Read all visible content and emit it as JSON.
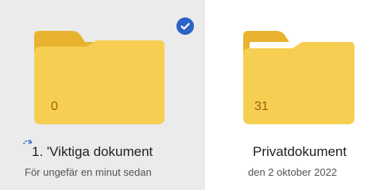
{
  "colors": {
    "accent": "#2c62c8",
    "folder_front": "#f6cf52",
    "folder_back": "#e9b330",
    "count_text": "#a05f0a",
    "selected_bg": "#ebebeb"
  },
  "folders": [
    {
      "name": "1. 'Viktiga dokument",
      "count": "0",
      "modified": "För ungefär en minut sedan",
      "selected": true,
      "icon": "folder-icon",
      "status_icon": "sync-icon"
    },
    {
      "name": "Privatdokument",
      "count": "31",
      "modified": "den 2 oktober 2022",
      "selected": false,
      "icon": "folder-with-contents-icon"
    }
  ]
}
